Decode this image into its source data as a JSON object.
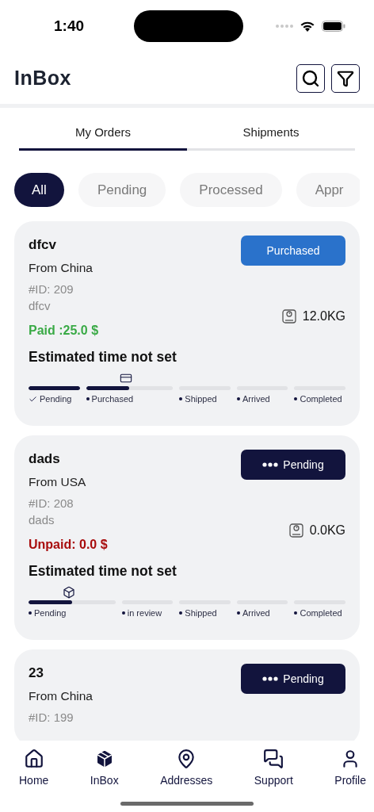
{
  "status_bar": {
    "time": "1:40"
  },
  "header": {
    "title": "InBox"
  },
  "tabs": [
    {
      "label": "My Orders",
      "selected": true
    },
    {
      "label": "Shipments",
      "selected": false
    }
  ],
  "filters": [
    {
      "label": "All",
      "selected": true
    },
    {
      "label": "Pending",
      "selected": false
    },
    {
      "label": "Processed",
      "selected": false
    },
    {
      "label": "Appr",
      "selected": false
    }
  ],
  "orders": [
    {
      "title": "dfcv",
      "origin": "From China",
      "id": "#ID: 209",
      "note": "dfcv",
      "amount": "Paid :25.0 $",
      "paid": true,
      "status": "Purchased",
      "kind": "purchased",
      "weight": "12.0KG",
      "eta": "Estimated time not set",
      "steps": [
        {
          "label": "Pending",
          "level": 1,
          "done": true,
          "current": false
        },
        {
          "label": "Purchased",
          "level": 0.5,
          "done": false,
          "current": true
        },
        {
          "label": "Shipped",
          "level": 0,
          "done": false,
          "current": false
        },
        {
          "label": "Arrived",
          "level": 0,
          "done": false,
          "current": false
        },
        {
          "label": "Completed",
          "level": 0,
          "done": false,
          "current": false
        }
      ]
    },
    {
      "title": "dads",
      "origin": "From USA",
      "id": "#ID: 208",
      "note": "dads",
      "amount": "Unpaid: 0.0 $",
      "paid": false,
      "status": "Pending",
      "kind": "pending",
      "weight": "0.0KG",
      "eta": "Estimated time not set",
      "steps": [
        {
          "label": "Pending",
          "level": 0.5,
          "done": false,
          "current": true
        },
        {
          "label": "in review",
          "level": 0,
          "done": false,
          "current": false
        },
        {
          "label": "Shipped",
          "level": 0,
          "done": false,
          "current": false
        },
        {
          "label": "Arrived",
          "level": 0,
          "done": false,
          "current": false
        },
        {
          "label": "Completed",
          "level": 0,
          "done": false,
          "current": false
        }
      ]
    },
    {
      "title": "23",
      "origin": "From China",
      "id": "#ID: 199",
      "status": "Pending",
      "kind": "pending"
    }
  ],
  "nav": [
    {
      "label": "Home",
      "selected": false
    },
    {
      "label": "InBox",
      "selected": true
    },
    {
      "label": "Addresses",
      "selected": false
    },
    {
      "label": "Support",
      "selected": false
    },
    {
      "label": "Profile",
      "selected": false
    }
  ]
}
